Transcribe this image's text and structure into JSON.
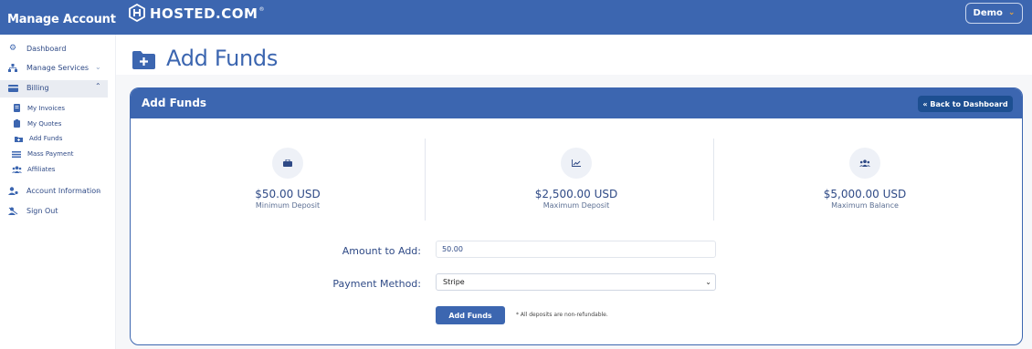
{
  "colors": {
    "brand": "#3c66b0",
    "brand_dark": "#1d4f91",
    "accent": "#f0a73a",
    "text": "#2f4a86"
  },
  "header": {
    "manage_title": "Manage Account",
    "brand_name": "HOSTED.COM",
    "brand_reg": "®",
    "user_menu_label": "Demo"
  },
  "sidebar": {
    "items": [
      {
        "label": "Dashboard",
        "icon": "gears-icon"
      },
      {
        "label": "Manage Services",
        "icon": "sitemap-icon"
      },
      {
        "label": "Billing",
        "icon": "card-icon"
      },
      {
        "label": "Account Information",
        "icon": "user-gear-icon"
      },
      {
        "label": "Sign Out",
        "icon": "sign-out-icon"
      }
    ],
    "billing_sub": [
      {
        "label": "My Invoices",
        "icon": "invoice-icon"
      },
      {
        "label": "My Quotes",
        "icon": "clipboard-icon"
      },
      {
        "label": "Add Funds",
        "icon": "folder-plus-icon"
      },
      {
        "label": "Mass Payment",
        "icon": "list-icon"
      },
      {
        "label": "Affiliates",
        "icon": "users-icon"
      }
    ]
  },
  "page": {
    "title": "Add Funds"
  },
  "card": {
    "title": "Add Funds",
    "back_label": "« Back to Dashboard",
    "stats": [
      {
        "value": "$50.00 USD",
        "label": "Minimum Deposit",
        "icon": "briefcase-icon"
      },
      {
        "value": "$2,500.00 USD",
        "label": "Maximum Deposit",
        "icon": "chart-icon"
      },
      {
        "value": "$5,000.00 USD",
        "label": "Maximum Balance",
        "icon": "users-icon"
      }
    ],
    "form": {
      "amount_label": "Amount to Add:",
      "amount_value": "50.00",
      "payment_label": "Payment Method:",
      "payment_selected": "Stripe",
      "submit_label": "Add Funds",
      "note": "* All deposits are non-refundable."
    }
  }
}
